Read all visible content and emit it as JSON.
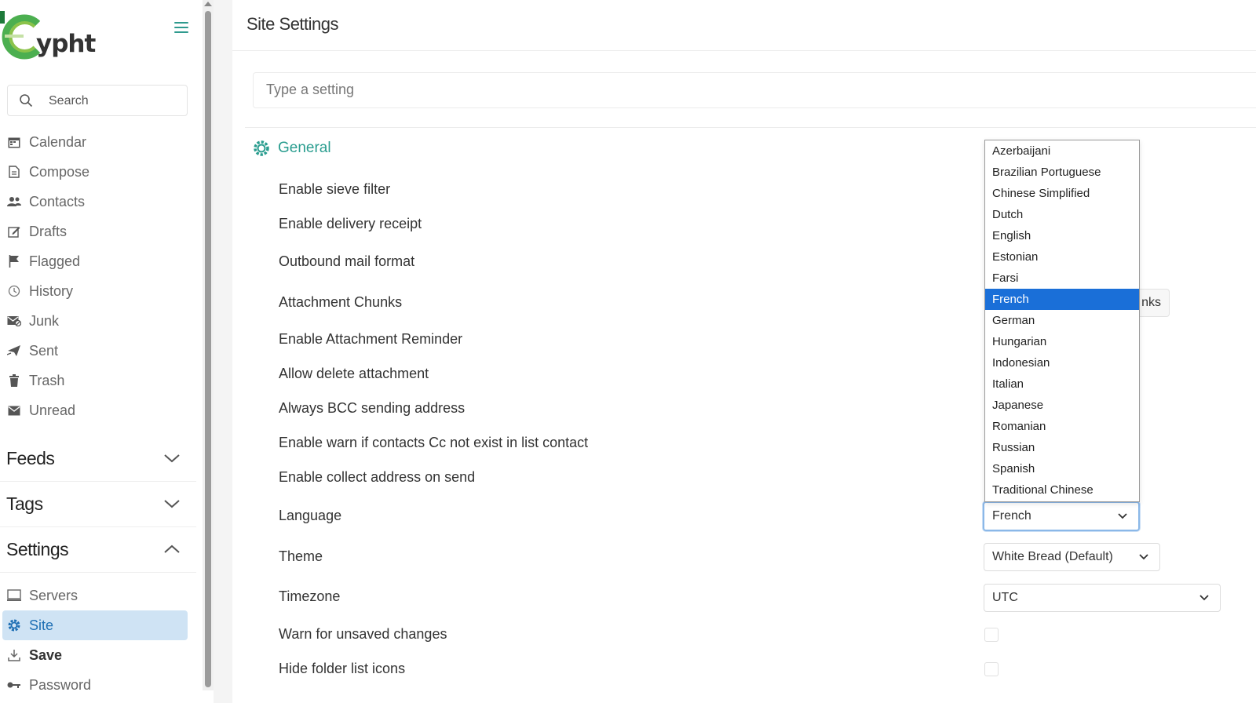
{
  "app": {
    "logo_text": "ypht"
  },
  "sidebar": {
    "search_placeholder": "Search",
    "folders": [
      {
        "label": "Calendar",
        "icon": "calendar-icon"
      },
      {
        "label": "Compose",
        "icon": "compose-icon"
      },
      {
        "label": "Contacts",
        "icon": "contacts-icon"
      },
      {
        "label": "Drafts",
        "icon": "drafts-icon"
      },
      {
        "label": "Flagged",
        "icon": "flag-icon"
      },
      {
        "label": "History",
        "icon": "history-icon"
      },
      {
        "label": "Junk",
        "icon": "junk-icon"
      },
      {
        "label": "Sent",
        "icon": "sent-icon"
      },
      {
        "label": "Trash",
        "icon": "trash-icon"
      },
      {
        "label": "Unread",
        "icon": "envelope-icon"
      }
    ],
    "sections": {
      "feeds": "Feeds",
      "tags": "Tags",
      "settings": "Settings"
    },
    "settings_items": [
      {
        "label": "Servers",
        "icon": "servers-icon"
      },
      {
        "label": "Site",
        "icon": "gear-icon",
        "active": true
      },
      {
        "label": "Save",
        "icon": "download-icon"
      },
      {
        "label": "Password",
        "icon": "key-icon"
      }
    ]
  },
  "main": {
    "title": "Site Settings",
    "search_placeholder": "Type a setting",
    "section_title": "General",
    "rows": [
      "Enable sieve filter",
      "Enable delivery receipt",
      "Outbound mail format",
      "Attachment Chunks",
      "Enable Attachment Reminder",
      "Allow delete attachment",
      "Always BCC sending address",
      "Enable warn if contacts Cc not exist in list contact",
      "Enable collect address on send",
      "Language",
      "Theme",
      "Timezone",
      "Warn for unsaved changes",
      "Hide folder list icons"
    ],
    "chunks_button_partial": "nks",
    "language": {
      "selected": "French",
      "options": [
        "Azerbaijani",
        "Brazilian Portuguese",
        "Chinese Simplified",
        "Dutch",
        "English",
        "Estonian",
        "Farsi",
        "French",
        "German",
        "Hungarian",
        "Indonesian",
        "Italian",
        "Japanese",
        "Romanian",
        "Russian",
        "Spanish",
        "Traditional Chinese"
      ]
    },
    "theme": {
      "selected": "White Bread (Default)"
    },
    "timezone": {
      "selected": "UTC"
    }
  },
  "colors": {
    "accent": "#2a9d8f",
    "active_bg": "#cfe3f4",
    "selected_option": "#1a6fd8"
  }
}
